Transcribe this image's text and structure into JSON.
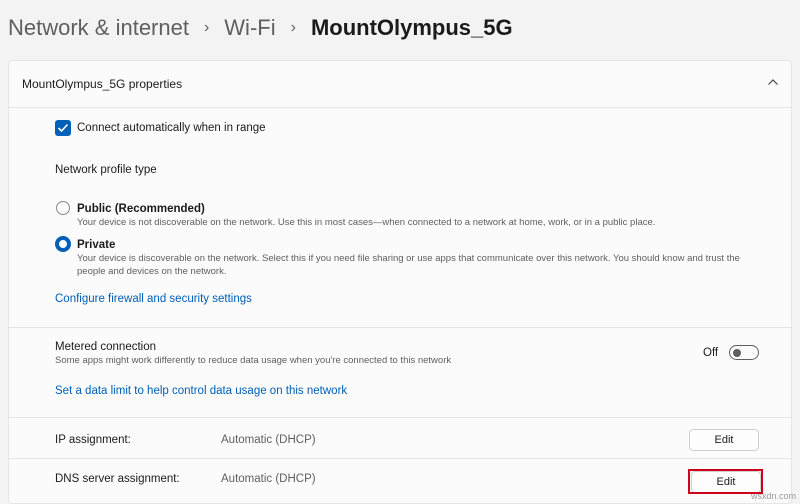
{
  "breadcrumb": {
    "items": [
      "Network & internet",
      "Wi-Fi"
    ],
    "current": "MountOlympus_5G"
  },
  "card": {
    "title": "MountOlympus_5G properties",
    "connect_auto": {
      "label": "Connect automatically when in range",
      "checked": true
    },
    "profile": {
      "heading": "Network profile type",
      "public": {
        "label": "Public (Recommended)",
        "desc": "Your device is not discoverable on the network. Use this in most cases—when connected to a network at home, work, or in a public place.",
        "selected": false
      },
      "private": {
        "label": "Private",
        "desc": "Your device is discoverable on the network. Select this if you need file sharing or use apps that communicate over this network. You should know and trust the people and devices on the network.",
        "selected": true
      }
    },
    "firewall_link": "Configure firewall and security settings",
    "metered": {
      "label": "Metered connection",
      "desc": "Some apps might work differently to reduce data usage when you're connected to this network",
      "state": "Off"
    },
    "data_limit_link": "Set a data limit to help control data usage on this network",
    "ip": {
      "label": "IP assignment:",
      "value": "Automatic (DHCP)",
      "button": "Edit"
    },
    "dns": {
      "label": "DNS server assignment:",
      "value": "Automatic (DHCP)",
      "button": "Edit"
    }
  },
  "watermark": "wsxdn.com",
  "colors": {
    "accent": "#005fb8",
    "highlight": "#d0021b"
  }
}
